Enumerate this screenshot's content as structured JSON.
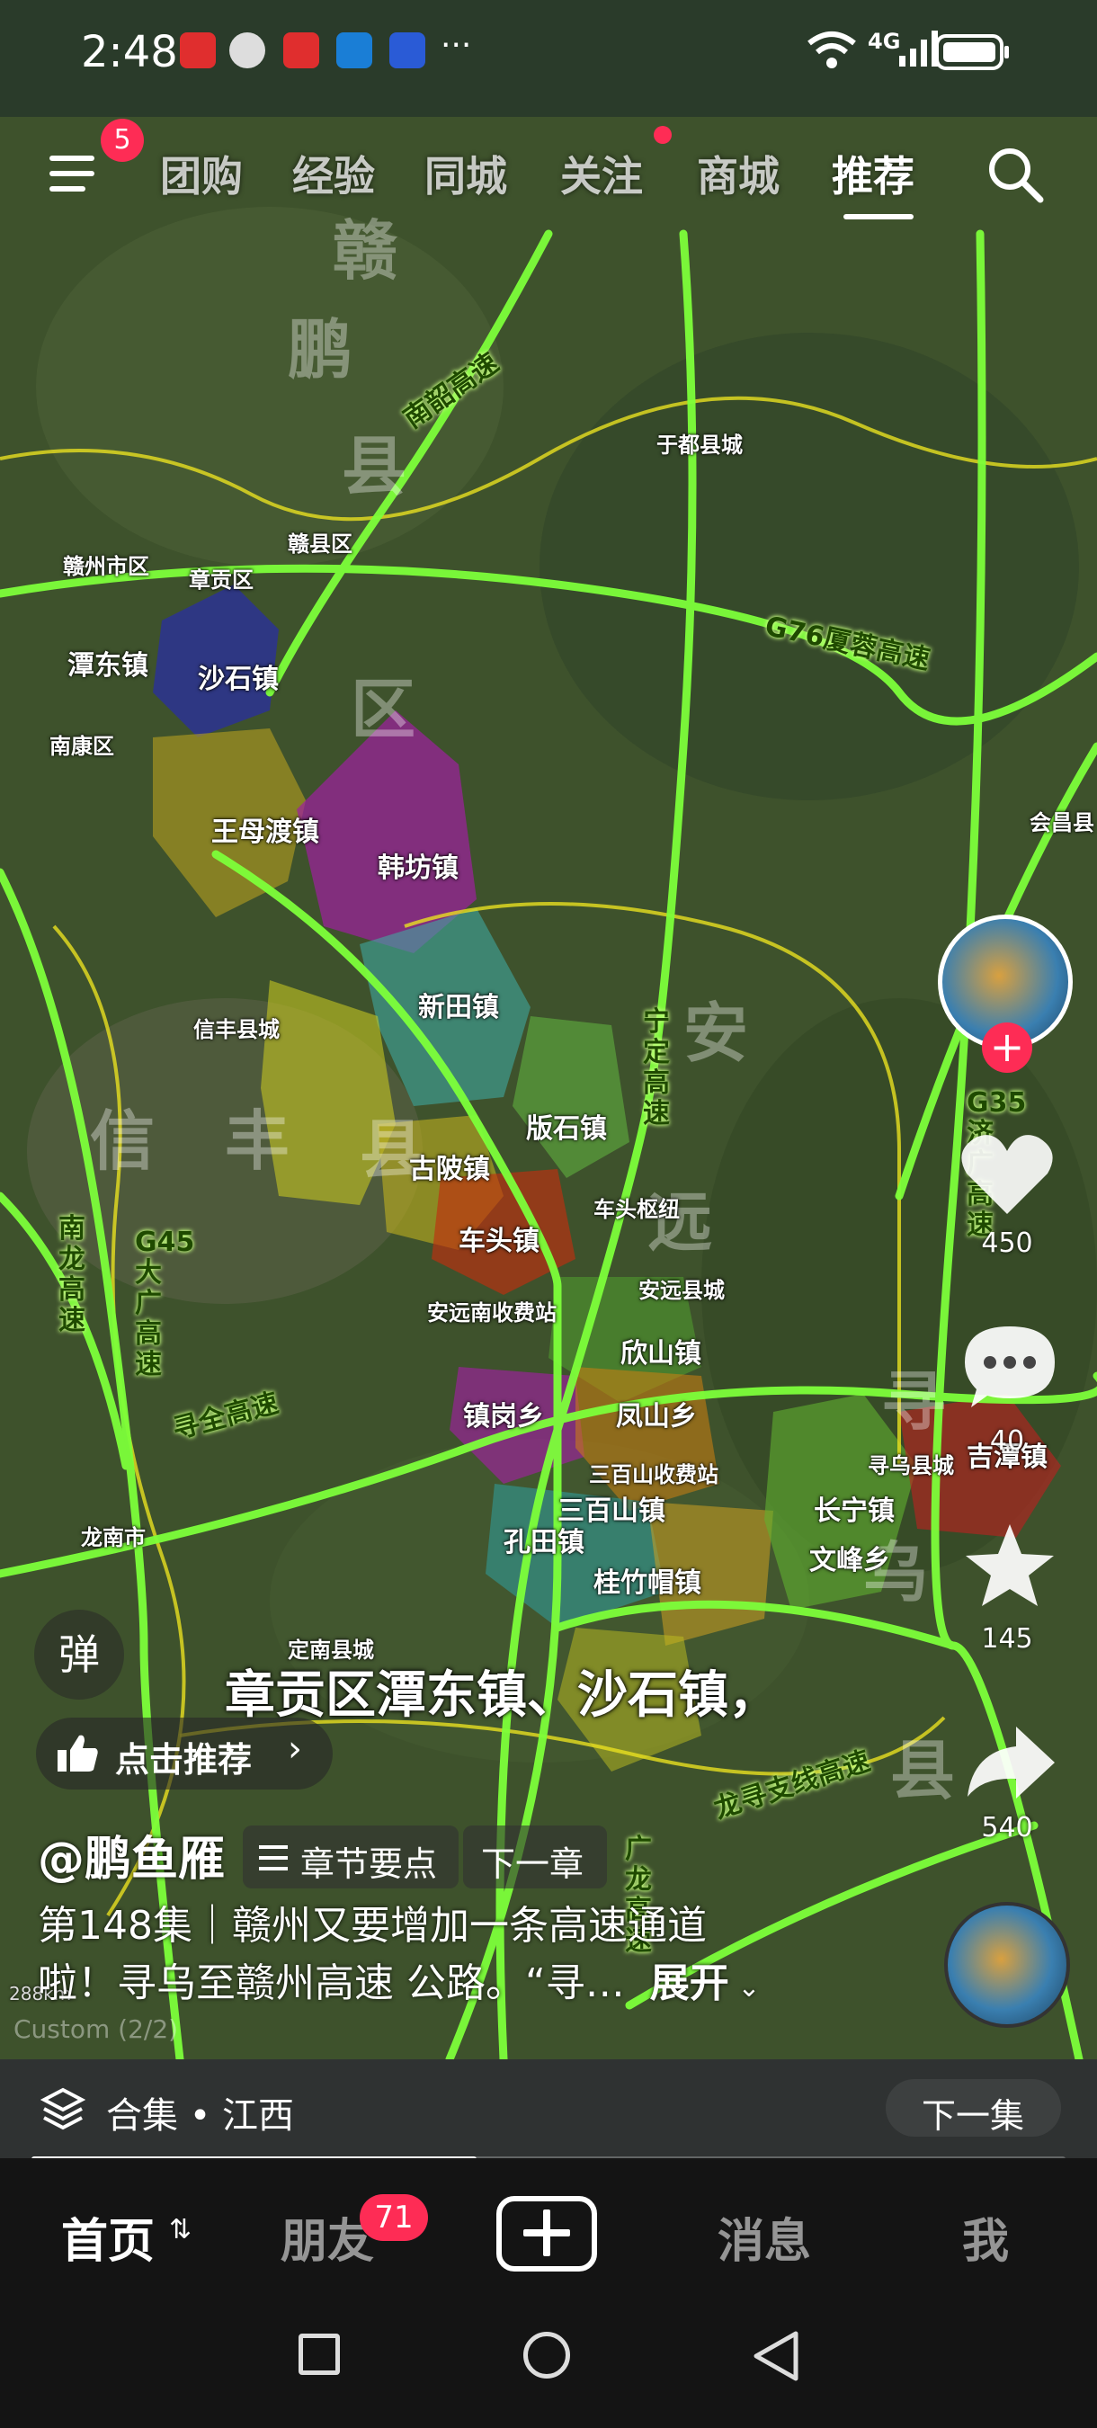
{
  "status_bar": {
    "time": "2:48",
    "signal": "4G",
    "more": "···",
    "app_icons": [
      "huawei-icon",
      "avatar-icon",
      "huawei-icon",
      "browser-icon",
      "lightbulb-icon"
    ]
  },
  "top_nav": {
    "menu_badge": "5",
    "tabs": [
      "团购",
      "经验",
      "同城",
      "关注",
      "商城",
      "推荐"
    ],
    "active_tab": "推荐"
  },
  "map": {
    "big_labels": [
      "赣",
      "鹏",
      "县",
      "区",
      "信",
      "丰",
      "县",
      "安",
      "远",
      "县",
      "寻",
      "乌",
      "县"
    ],
    "place_labels": {
      "ganzhou": "赣州市区",
      "zhanggong": "章贡区",
      "ganxian": "赣县区",
      "yudu": "于都县城",
      "tandong": "潭东镇",
      "shashi": "沙石镇",
      "nankang": "南康区",
      "wangmudu": "王母渡镇",
      "hanfang": "韩坊镇",
      "xintian": "新田镇",
      "xinfeng": "信丰县城",
      "banshi": "版石镇",
      "gubei": "古陂镇",
      "chetou_hub": "车头枢纽",
      "chetou": "车头镇",
      "anyuan_south": "安远南收费站",
      "anyuan": "安远县城",
      "xinshan": "欣山镇",
      "zhengang": "镇岗乡",
      "fengshan": "凤山乡",
      "sanbaishan_toll": "三百山收费站",
      "sanbaishan": "三百山镇",
      "kongtian": "孔田镇",
      "xunwu": "寻乌县城",
      "changning": "长宁镇",
      "wenfeng": "文峰乡",
      "jitan": "吉潭镇",
      "guizhumao": "桂竹帽镇",
      "longnan": "龙南市",
      "dingnan": "定南县城",
      "huichang": "会昌县"
    },
    "highway_labels": {
      "nanshao": "南韶高速",
      "g76": "G76厦蓉高速",
      "ningding": "宁定高速",
      "nanlong": "南龙高速",
      "g45": "G45大广高速",
      "xunquan": "寻全高速",
      "g35": "G35济广高速",
      "longxun": "龙寻支线高速",
      "guanglong": "广龙高速"
    },
    "scale_text": "288km",
    "custom_text": "Custom (2/2)"
  },
  "actions": {
    "likes": "450",
    "comments": "40",
    "favorites": "145",
    "shares": "540"
  },
  "danmu_label": "弹",
  "caption": "章贡区潭东镇、沙石镇，",
  "recommend_chip": "点击推荐",
  "author": "@鹏鱼雁",
  "chapter_chip": "章节要点",
  "next_chapter": "下一章",
  "description_line1": "第148集｜赣州又要增加一条高速通道",
  "description_line2": "啦！寻乌至赣州高速 公路。“寻…",
  "expand": "展开",
  "collection": {
    "label": "合集 • 江西",
    "next": "下一集",
    "progress": 0.43
  },
  "bottom_nav": {
    "home": "首页",
    "friends": "朋友",
    "friends_badge": "71",
    "messages": "消息",
    "me": "我"
  },
  "colors": {
    "highway": "#7dff3a",
    "badge": "#fe2c55",
    "map_bg": "#3b4f2c"
  }
}
